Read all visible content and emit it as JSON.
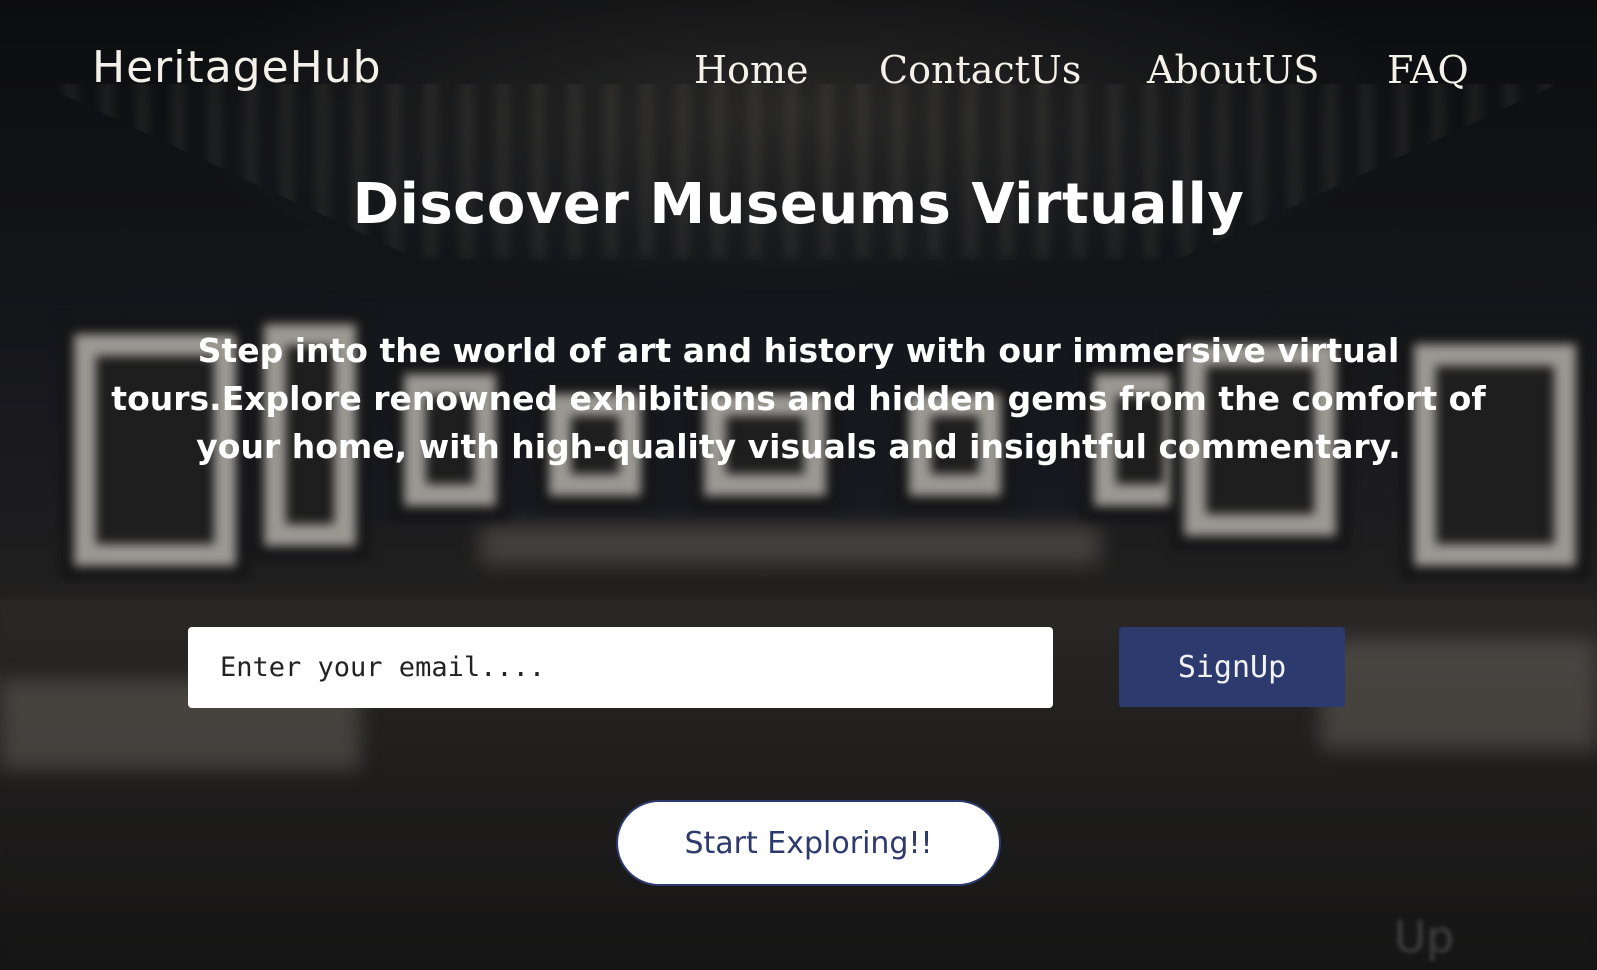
{
  "brand": {
    "name": "HeritageHub"
  },
  "nav": {
    "items": [
      {
        "label": "Home"
      },
      {
        "label": "ContactUs"
      },
      {
        "label": "AboutUS"
      },
      {
        "label": "FAQ"
      }
    ]
  },
  "hero": {
    "title": "Discover Museums Virtually",
    "description": "Step into the world of art and history with our immersive virtual tours.Explore renowned exhibitions and hidden gems from the comfort of your home, with high-quality visuals and insightful commentary."
  },
  "signup": {
    "email_placeholder": "Enter your email....",
    "email_value": "",
    "button_label": "SignUp"
  },
  "cta": {
    "label": "Start Exploring!!"
  },
  "background": {
    "watermark": "Up"
  },
  "colors": {
    "accent": "#2c3a6d",
    "text": "#ffffff",
    "input_bg": "#ffffff"
  }
}
